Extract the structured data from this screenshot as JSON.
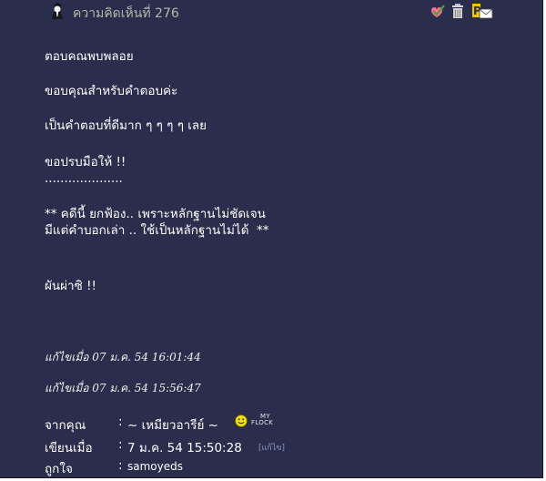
{
  "header": {
    "comment_label": "ความคิดเห็นที่ 276",
    "icons": [
      "user-avatar-icon",
      "check-heart-icon",
      "trash-icon",
      "pm-mail-icon"
    ]
  },
  "body": {
    "lines": [
      "ตอบคณพบพลอย",
      "ขอบคุณสำหรับคำตอบค่ะ",
      "เป็นคำตอบที่ดีมาก ๆ ๆ ๆ ๆ เลย",
      "ขอปรบมือให้ !!",
      "....................",
      "** คดีนี้ ยกฟ้อง.. เพราะหลักฐานไม่ชัดเจน",
      "มีแต่คำบอกเล่า .. ใช้เป็นหลักฐานไม่ได้  **",
      "ผันผ่าซิ !!"
    ]
  },
  "edits": [
    "แก้ไขเมื่อ 07 ม.ค. 54 16:01:44",
    "แก้ไขเมื่อ 07 ม.ค. 54 15:56:47"
  ],
  "meta": {
    "from_label": "จากคุณ",
    "from_value": "~ เหมียวอารีย์ ~",
    "myflock_my": "MY",
    "myflock_flock": "FLOCK",
    "written_label": "เขียนเมื่อ",
    "written_value": "7 ม.ค. 54 15:50:28",
    "edit_link": "[แก้ไข]",
    "like_label": "ถูกใจ",
    "like_value": "samoyeds",
    "separator": ":"
  },
  "colors": {
    "background": "#2b2d4c",
    "header_text": "#b0b9a9",
    "body_text": "#ffffff",
    "edit_link": "#8d95bb"
  }
}
